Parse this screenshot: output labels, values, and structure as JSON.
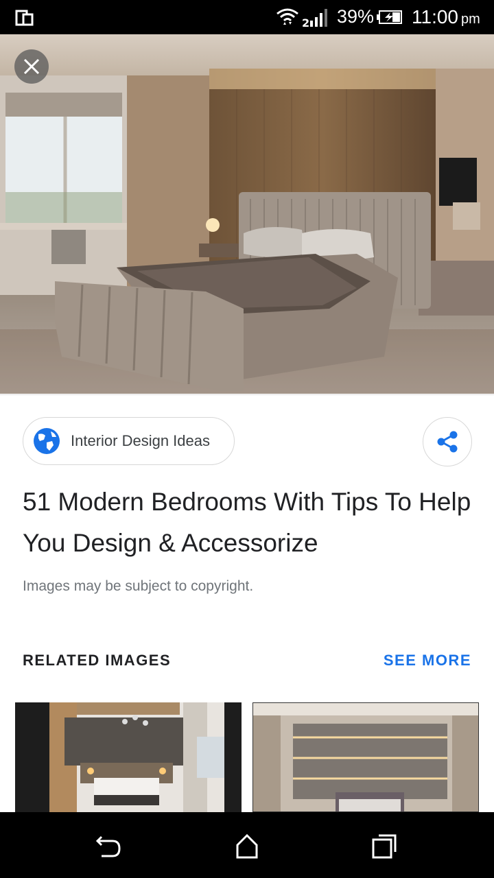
{
  "status_bar": {
    "battery": "39%",
    "time": "11:00",
    "ampm": "pm"
  },
  "source": {
    "name": "Interior Design Ideas"
  },
  "title": "51 Modern Bedrooms With Tips To Help You Design & Accessorize",
  "copyright": "Images may be subject to copyright.",
  "related": {
    "heading": "RELATED IMAGES",
    "see_more": "SEE MORE"
  },
  "icons": {
    "close": "close-icon",
    "share": "share-icon",
    "source": "globe-icon",
    "back": "back-icon",
    "home": "home-icon",
    "recents": "recents-icon"
  },
  "colors": {
    "accent": "#1a73e8",
    "title": "#202124",
    "secondary": "#70757a"
  }
}
